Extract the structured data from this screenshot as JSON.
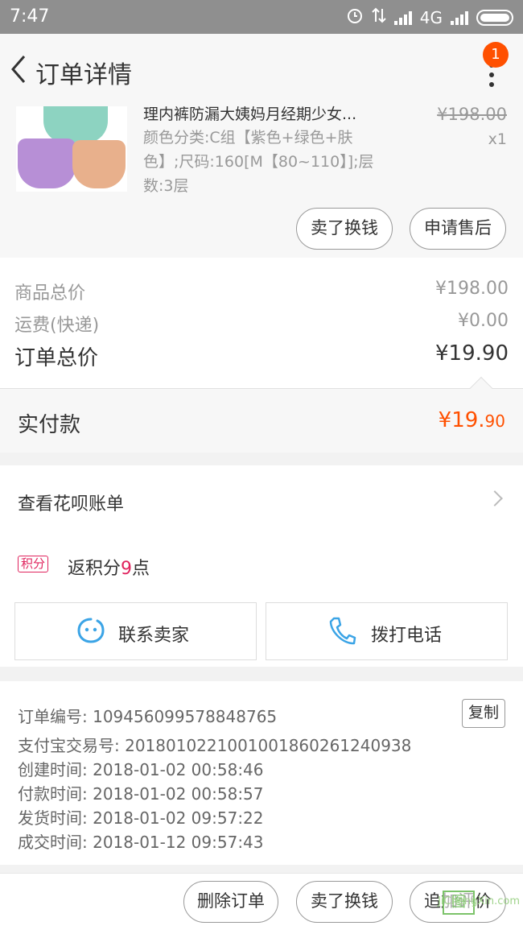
{
  "status_bar": {
    "time": "7:47",
    "network": "4G"
  },
  "header": {
    "title": "订单详情",
    "badge_count": "1"
  },
  "product": {
    "name": "理内裤防漏大姨妈月经期少女...",
    "sku_line1": "颜色分类:C组【紫色+绿色+肤",
    "sku_line2": "色】;尺码:160[M【80~110】];层",
    "sku_line3": "数:3层",
    "original_price": "¥198.00",
    "quantity": "x1",
    "btn_sell": "卖了换钱",
    "btn_after_sale": "申请售后"
  },
  "summary": {
    "goods_label": "商品总价",
    "goods_value": "¥198.00",
    "shipping_label": "运费(快递)",
    "shipping_value": "¥0.00",
    "total_label": "订单总价",
    "total_value": "¥19.90",
    "paid_label": "实付款",
    "paid_int": "¥19.",
    "paid_dec": "90"
  },
  "huabei": {
    "label": "查看花呗账单"
  },
  "points": {
    "tag": "积分",
    "prefix": "返积分",
    "amount": "9",
    "suffix": "点"
  },
  "actions": {
    "contact_seller": "联系卖家",
    "call": "拨打电话"
  },
  "order_info": {
    "order_no": "订单编号: 109456099578848765",
    "alipay_no": "支付宝交易号: 2018010221001001860261240938",
    "created": "创建时间: 2018-01-02 00:58:46",
    "paid": "付款时间: 2018-01-02 00:58:57",
    "shipped": "发货时间: 2018-01-02 09:57:22",
    "completed": "成交时间: 2018-01-12 09:57:43",
    "copy_label": "复制"
  },
  "bottom": {
    "delete": "删除订单",
    "sell": "卖了换钱",
    "review": "追加评价"
  },
  "watermark": {
    "text": "JiChengXin.com",
    "box": "图"
  },
  "colors": {
    "accent": "#ff5000",
    "points": "#e0245e",
    "icon_blue": "#3ba4e6"
  }
}
